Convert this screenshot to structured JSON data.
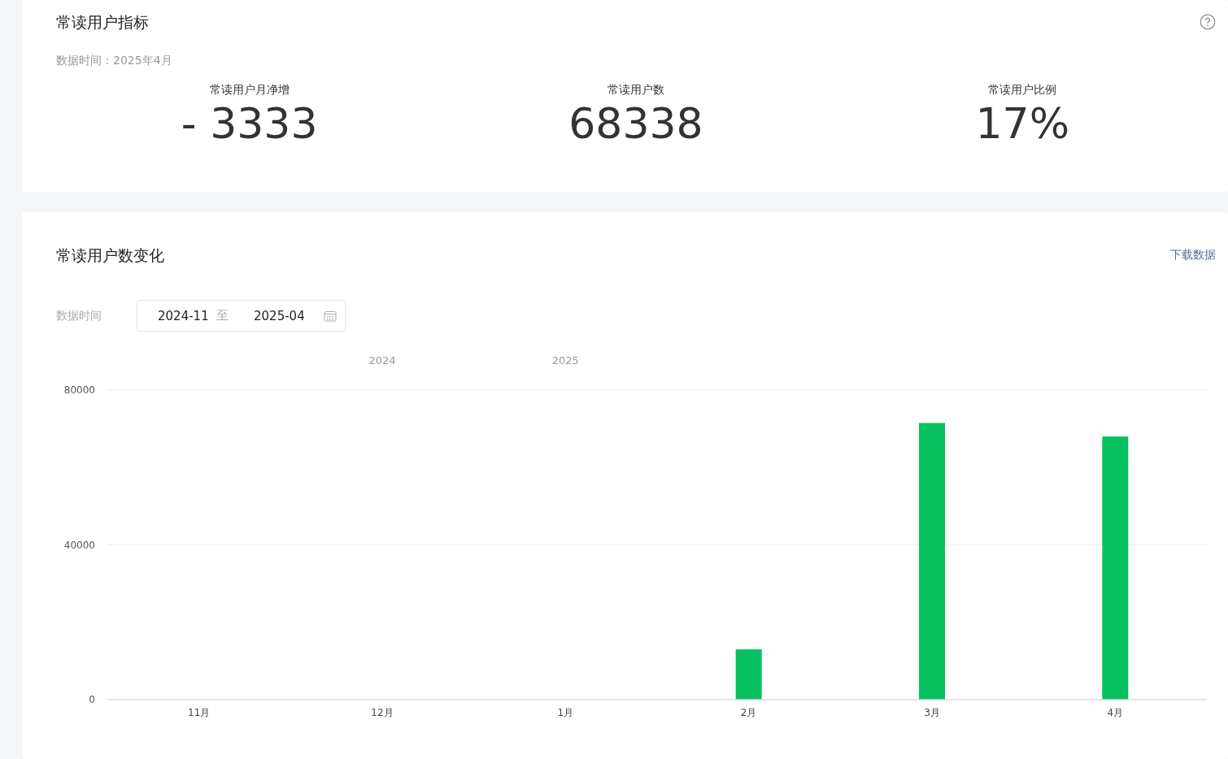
{
  "metrics_card": {
    "title": "常读用户指标",
    "data_time": "数据时间：2025年4月",
    "metrics": [
      {
        "label": "常读用户月净增",
        "value": "- 3333"
      },
      {
        "label": "常读用户数",
        "value": "68338"
      },
      {
        "label": "常读用户比例",
        "value": "17%"
      }
    ]
  },
  "trend_card": {
    "title": "常读用户数变化",
    "download_link": "下载数据",
    "filter_label": "数据时间",
    "date_range": {
      "start": "2024-11",
      "separator": "至",
      "end": "2025-04"
    },
    "chart_data": {
      "type": "bar",
      "categories": [
        "11月",
        "12月",
        "1月",
        "2月",
        "3月",
        "4月"
      ],
      "series": [
        {
          "color": "#07c160",
          "values": [
            0,
            0,
            0,
            13000,
            71500,
            68000
          ]
        }
      ],
      "ylim": [
        0,
        80000
      ],
      "yticks": [
        0,
        40000,
        80000
      ]
    },
    "year_labels": [
      "2024",
      "2025"
    ]
  }
}
